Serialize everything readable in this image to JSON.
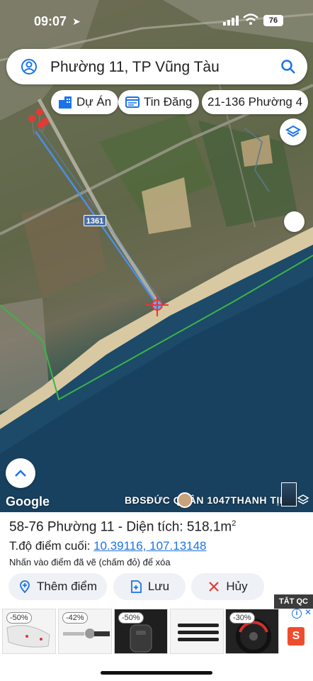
{
  "status_bar": {
    "time": "09:07",
    "battery": "76"
  },
  "search": {
    "query": "Phường 11, TP Vũng Tàu"
  },
  "chips": [
    {
      "label": "Dự Án",
      "icon": "building-icon"
    },
    {
      "label": "Tin Đăng",
      "icon": "listing-icon"
    },
    {
      "label": "21-136 Phường 4"
    }
  ],
  "map": {
    "road_label": "1361",
    "attribution": "Google",
    "watermark": "BĐSĐỨC QUÂN 1047THANH TỊNH",
    "colors": {
      "route_line": "#4a8fe7",
      "boundary": "#3db34a",
      "marker": "#e53935"
    }
  },
  "panel": {
    "title_prefix": "58-76 Phường 11 - Diện tích: 518.1m",
    "title_sup": "2",
    "coords_label": "T.độ điểm cuối: ",
    "coords_value": "10.39116, 107.13148",
    "hint": "Nhấn vào điểm đã vẽ (chấm đỏ) để xóa",
    "buttons": {
      "add_point": "Thêm điểm",
      "save": "Lưu",
      "cancel": "Hủy"
    }
  },
  "ads": {
    "tag": "TẮT QC",
    "items": [
      {
        "discount": "-50%"
      },
      {
        "discount": "-42%"
      },
      {
        "discount": "-50%"
      },
      {
        "discount": ""
      },
      {
        "discount": "-30%"
      }
    ]
  }
}
